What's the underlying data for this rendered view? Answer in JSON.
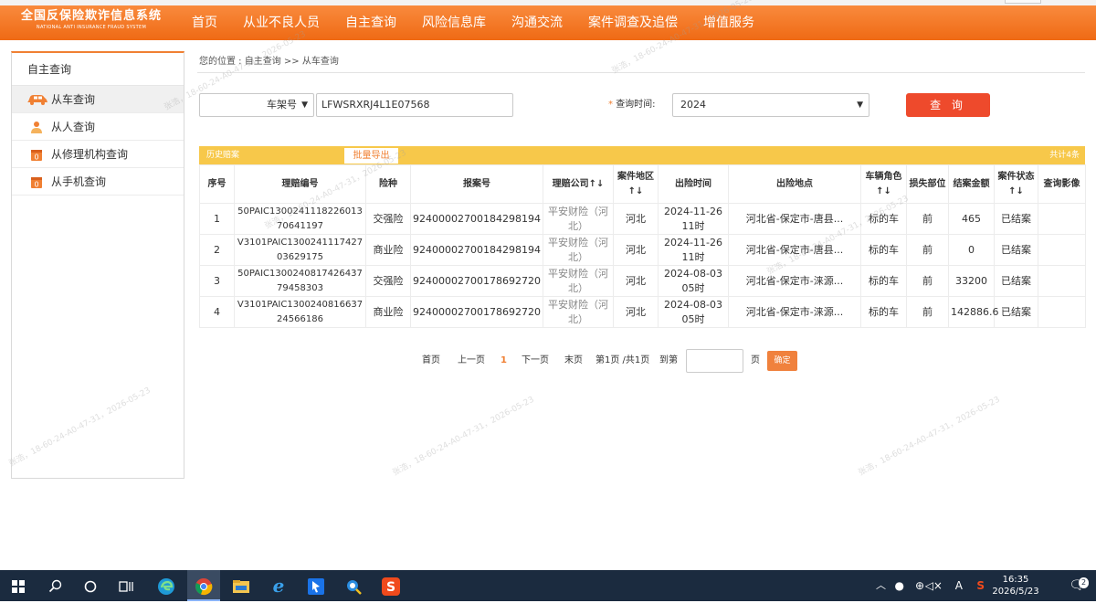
{
  "logo": {
    "title_cn": "全国反保险欺诈信息系统",
    "title_en": "NATIONAL ANTI INSURANCE FRAUD SYSTEM"
  },
  "nav": [
    "首页",
    "从业不良人员",
    "自主查询",
    "风险信息库",
    "沟通交流",
    "案件调查及追偿",
    "增值服务"
  ],
  "sidebar": {
    "title": "自主查询",
    "items": [
      {
        "label": "从车查询",
        "icon": "car-icon",
        "active": true
      },
      {
        "label": "从人查询",
        "icon": "person-icon",
        "active": false
      },
      {
        "label": "从修理机构查询",
        "icon": "repair-shop-icon",
        "active": false
      },
      {
        "label": "从手机查询",
        "icon": "phone-icon",
        "active": false
      }
    ]
  },
  "breadcrumb": "您的位置 : 自主查询 >> 从车查询",
  "search": {
    "field_type": "车架号",
    "vin_value": "LFWSRXRJ4L1E07568",
    "time_label": "查询时间:",
    "time_required_mark": "*",
    "year": "2024",
    "query_button": "查 询"
  },
  "history": {
    "title": "历史赔案",
    "export_button": "批量导出",
    "total": "共计4条"
  },
  "table": {
    "headers": [
      "序号",
      "理赔编号",
      "险种",
      "报案号",
      "理赔公司↑↓",
      "案件地区↑↓",
      "出险时间",
      "出险地点",
      "车辆角色↑↓",
      "损失部位",
      "结案金额",
      "案件状态↑↓",
      "查询影像"
    ],
    "rows": [
      [
        "1",
        "50PAIC1300241118226013 70641197",
        "交强险",
        "92400002700184298194",
        "平安财险（河北）",
        "河北",
        "2024-11-26 11时",
        "河北省-保定市-唐县...",
        "标的车",
        "前",
        "465",
        "已结案",
        ""
      ],
      [
        "2",
        "V3101PAIC1300241117427 03629175",
        "商业险",
        "92400002700184298194",
        "平安财险（河北）",
        "河北",
        "2024-11-26 11时",
        "河北省-保定市-唐县...",
        "标的车",
        "前",
        "0",
        "已结案",
        ""
      ],
      [
        "3",
        "50PAIC1300240817426437 79458303",
        "交强险",
        "92400002700178692720",
        "平安财险（河北）",
        "河北",
        "2024-08-03 05时",
        "河北省-保定市-涞源...",
        "标的车",
        "前",
        "33200",
        "已结案",
        ""
      ],
      [
        "4",
        "V3101PAIC1300240816637 24566186",
        "商业险",
        "92400002700178692720",
        "平安财险（河北）",
        "河北",
        "2024-08-03 05时",
        "河北省-保定市-涞源...",
        "标的车",
        "前",
        "142886.6",
        "已结案",
        ""
      ]
    ]
  },
  "pager": {
    "first": "首页",
    "prev": "上一页",
    "current": "1",
    "next": "下一页",
    "last": "末页",
    "info": "第1页 /共1页",
    "goto": "到第",
    "page_unit": "页",
    "ok": "确定"
  },
  "watermark": "张浩，18-60-24-A0-47-31，2026-05-23",
  "taskbar": {
    "time": "16:35",
    "date": "2026/5/23",
    "ime": "A",
    "notification_count": "2",
    "apps": [
      "windows-start-icon",
      "search-icon",
      "cortana-icon",
      "task-view-icon",
      "edge-icon",
      "chrome-icon",
      "file-explorer-icon",
      "ie-icon",
      "app-arrow-icon",
      "app-search-icon",
      "sogou-icon"
    ]
  },
  "colors": {
    "brand": "#ef6a14",
    "query_button": "#ee4a2c",
    "history_bar": "#f7c84a",
    "taskbar": "#1b2b3f"
  }
}
